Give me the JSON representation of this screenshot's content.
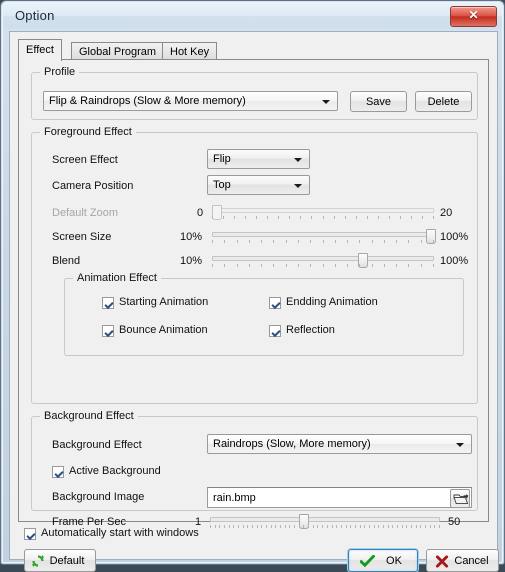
{
  "window": {
    "title": "Option",
    "close_label": "✕"
  },
  "tabs": [
    {
      "label": "Effect",
      "active": true
    },
    {
      "label": "Global Program",
      "active": false
    },
    {
      "label": "Hot Key",
      "active": false
    }
  ],
  "profile": {
    "group_title": "Profile",
    "selected": "Flip & Raindrops (Slow & More memory)",
    "save_label": "Save",
    "delete_label": "Delete"
  },
  "foreground": {
    "group_title": "Foreground Effect",
    "screen_effect_label": "Screen Effect",
    "screen_effect_value": "Flip",
    "camera_position_label": "Camera Position",
    "camera_position_value": "Top",
    "default_zoom_label": "Default Zoom",
    "default_zoom_min": "0",
    "default_zoom_max": "20",
    "default_zoom_percent": 0,
    "screen_size_label": "Screen Size",
    "screen_size_min": "10%",
    "screen_size_max": "100%",
    "screen_size_percent": 100,
    "blend_label": "Blend",
    "blend_min": "10%",
    "blend_max": "100%",
    "blend_percent": 68
  },
  "animation": {
    "group_title": "Animation Effect",
    "items": [
      {
        "label": "Starting Animation",
        "checked": true
      },
      {
        "label": "Endding Animation",
        "checked": true
      },
      {
        "label": "Bounce Animation",
        "checked": true
      },
      {
        "label": "Reflection",
        "checked": true
      }
    ]
  },
  "background": {
    "group_title": "Background Effect",
    "effect_label": "Background Effect",
    "effect_value": "Raindrops (Slow, More memory)",
    "active_label": "Active Background",
    "active_checked": true,
    "image_label": "Background Image",
    "image_value": "rain.bmp",
    "browse_icon": "open-folder-icon",
    "fps_label": "Frame Per Sec",
    "fps_min": "1",
    "fps_max": "50",
    "fps_percent": 40
  },
  "footer": {
    "autostart_label": "Automatically start with windows",
    "autostart_checked": true,
    "default_label": "Default",
    "default_icon": "refresh-icon",
    "ok_label": "OK",
    "ok_icon": "check-icon",
    "cancel_label": "Cancel",
    "cancel_icon": "cross-icon"
  },
  "colors": {
    "title_bar_start": "#e8f1f8",
    "title_bar_end": "#c9d8e6",
    "close_red": "#c32d1f",
    "accent_blue": "#3c7fb1",
    "check_blue": "#2c4f87",
    "ok_check_green": "#1a9e24",
    "cancel_red": "#b01d1d",
    "default_green": "#2fa82f"
  }
}
